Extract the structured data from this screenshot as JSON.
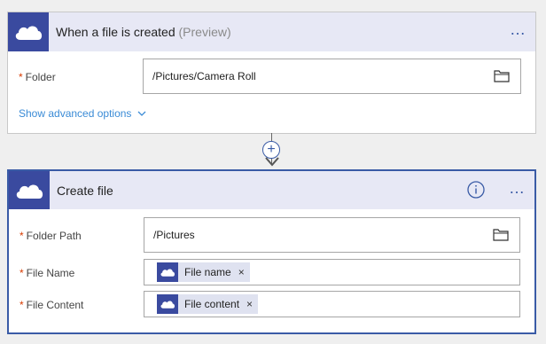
{
  "trigger": {
    "title": "When a file is created",
    "preview_tag": "(Preview)",
    "menu_glyph": "…",
    "fields": [
      {
        "required_mark": "*",
        "label": "Folder",
        "value": "/Pictures/Camera Roll",
        "icon": "folder-icon"
      }
    ],
    "advanced_link": "Show advanced options",
    "advanced_icon": "chevron-down-icon"
  },
  "connector": {
    "add_glyph": "+"
  },
  "action": {
    "title": "Create file",
    "info_icon": "info-icon",
    "menu_glyph": "…",
    "fields": [
      {
        "required_mark": "*",
        "label": "Folder Path",
        "value": "/Pictures",
        "icon": "folder-icon"
      },
      {
        "required_mark": "*",
        "label": "File Name",
        "token": "File name",
        "remove": "×"
      },
      {
        "required_mark": "*",
        "label": "File Content",
        "token": "File content",
        "remove": "×"
      }
    ]
  },
  "colors": {
    "brand": "#3a4a9f",
    "header_bg": "#e7e8f5",
    "link": "#3a8bd6",
    "required": "#d83b01",
    "selected_border": "#3a5ba6"
  }
}
